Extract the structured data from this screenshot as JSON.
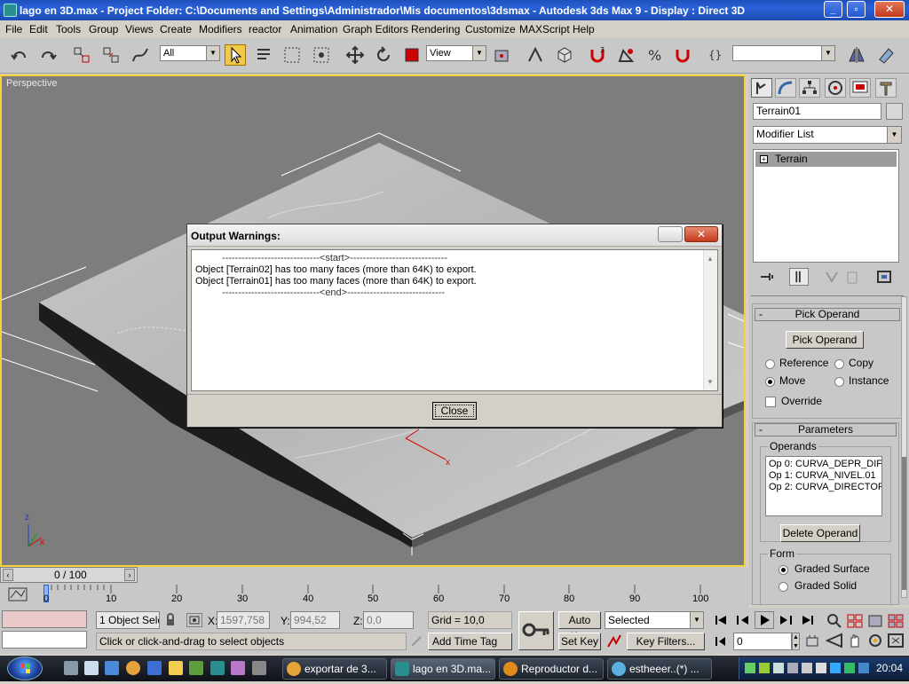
{
  "window": {
    "title": "lago en 3D.max     - Project Folder: C:\\Documents and Settings\\Administrador\\Mis documentos\\3dsmax     - Autodesk 3ds Max 9     - Display : Direct 3D",
    "minimize": "_",
    "maximize": "▫",
    "close": "✕"
  },
  "menu": [
    "File",
    "Edit",
    "Tools",
    "Group",
    "Views",
    "Create",
    "Modifiers",
    "reactor",
    "Animation",
    "Graph Editors",
    "Rendering",
    "Customize",
    "MAXScript",
    "Help"
  ],
  "toolbar": {
    "selection_filter": "All",
    "reference_coord": "View",
    "named_selection": ""
  },
  "viewport": {
    "label": "Perspective",
    "axis_x": "x",
    "axis_z": "z",
    "gizmo_label": "x"
  },
  "dialog": {
    "title": "Output Warnings:",
    "lines": [
      "------------------------------<start>------------------------------",
      "Object [Terrain02] has too many faces (more than 64K) to export.",
      "Object [Terrain01] has too many faces (more than 64K) to export.",
      "------------------------------<end>------------------------------"
    ],
    "close_label": "Close",
    "close_x": "✕"
  },
  "command_panel": {
    "object_name": "Terrain01",
    "modifier_list": "Modifier List",
    "stack_item": "Terrain",
    "pick_operand": {
      "header": "Pick Operand",
      "button": "Pick Operand",
      "options": [
        "Reference",
        "Copy",
        "Move",
        "Instance"
      ],
      "selected": "Move",
      "override": "Override"
    },
    "parameters": {
      "header": "Parameters",
      "operands_label": "Operands",
      "operands": [
        "Op 0: CURVA_DEPR_DIF",
        "Op 1: CURVA_NIVEL.01",
        "Op 2: CURVA_DIRECTOF"
      ],
      "delete_button": "Delete Operand",
      "form_label": "Form",
      "form_options": [
        "Graded Surface",
        "Graded Solid"
      ],
      "form_selected": "Graded Surface"
    },
    "minus": "-"
  },
  "timeline": {
    "frame": "0 / 100",
    "ticks": [
      "0",
      "10",
      "20",
      "30",
      "40",
      "50",
      "60",
      "70",
      "80",
      "90",
      "100"
    ]
  },
  "status": {
    "selection": "1 Object Sele",
    "x_label": "X:",
    "x_value": "1597,758",
    "y_label": "Y:",
    "y_value": "994,52",
    "z_label": "Z:",
    "z_value": "0,0",
    "grid": "Grid = 10,0",
    "prompt": "Click or click-and-drag to select objects",
    "add_time_tag": "Add Time Tag",
    "auto_key": "Auto Key",
    "set_key": "Set Key",
    "selected": "Selected",
    "key_filters": "Key Filters...",
    "frame_field": "0"
  },
  "taskbar": {
    "tasks": [
      "exportar de 3...",
      "lago en 3D.ma...",
      "Reproductor d...",
      "estheeer..(*) ..."
    ],
    "clock": "20:04"
  },
  "colors": {
    "viewport_border": "#f7d33a",
    "viewport_bg": "#7d7d7d",
    "active_tool": "#f2c84a",
    "stack_highlight": "#9c9c9c"
  }
}
